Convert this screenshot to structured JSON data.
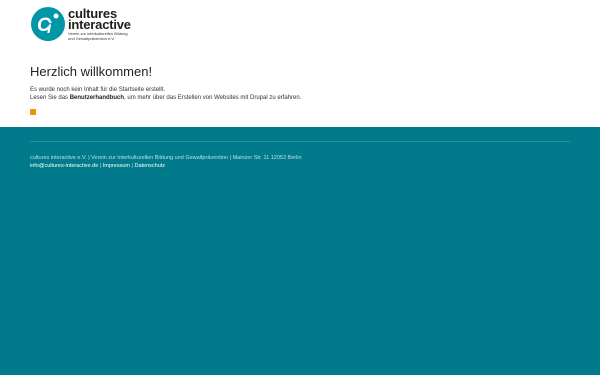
{
  "header": {
    "logo_name_line1": "cultures",
    "logo_name_line2": "interactive",
    "logo_tagline": "Verein zur interkulturellen Bildung und Gewaltprävention e.V."
  },
  "main": {
    "title": "Herzlich willkommen!",
    "line1": "Es wurde noch kein Inhalt für die Startseite erstellt.",
    "line2_pre": "Lesen Sie das ",
    "line2_link": "Benutzerhandbuch",
    "line2_post": ", um mehr über das Erstellen von Websites mit Drupal zu erfahren.",
    "feed_icon": "rss-icon"
  },
  "footer": {
    "address": "cultures interactive e.V. | Verein zur interkulturellen Bildung und Gewaltprävention | Mainzer Str. 11 12053 Berlin",
    "email": "info@cultures-interactive.de",
    "sep": "|",
    "impressum": "Impressum",
    "datenschutz": "Datenschutz"
  },
  "colors": {
    "footer_bg": "#017b8c",
    "logo_teal": "#0096a8",
    "rss_orange": "#f39200"
  }
}
